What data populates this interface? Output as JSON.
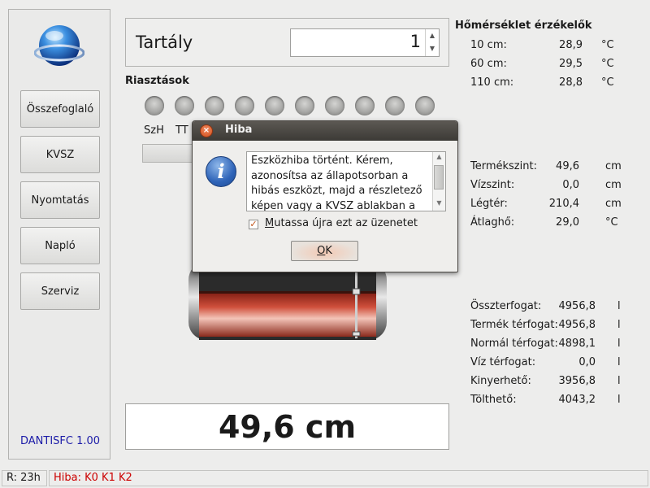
{
  "sidebar": {
    "buttons": [
      {
        "label": "Összefoglaló"
      },
      {
        "label": "KVSZ"
      },
      {
        "label": "Nyomtatás"
      },
      {
        "label": "Napló"
      },
      {
        "label": "Szerviz"
      }
    ],
    "version": "DANTISFC 1.00"
  },
  "tank_selector": {
    "label": "Tartály",
    "value": "1"
  },
  "alarms": {
    "title": "Riasztások",
    "led_count": 10,
    "labels": [
      "SzH",
      "TT"
    ]
  },
  "level_display": "49,6 cm",
  "temperature": {
    "title": "Hőmérséklet érzékelők",
    "rows": [
      {
        "label": "10 cm:",
        "value": "28,9",
        "unit": "°C"
      },
      {
        "label": "60 cm:",
        "value": "29,5",
        "unit": "°C"
      },
      {
        "label": "110 cm:",
        "value": "28,8",
        "unit": "°C"
      }
    ]
  },
  "levels": {
    "rows": [
      {
        "label": "Termékszint:",
        "value": "49,6",
        "unit": "cm"
      },
      {
        "label": "Vízszint:",
        "value": "0,0",
        "unit": "cm"
      },
      {
        "label": "Légtér:",
        "value": "210,4",
        "unit": "cm"
      },
      {
        "label": "Átlaghő:",
        "value": "29,0",
        "unit": "°C"
      }
    ]
  },
  "volumes": {
    "rows": [
      {
        "label": "Összterfogat:",
        "value": "4956,8",
        "unit": "l"
      },
      {
        "label": "Termék térfogat:",
        "value": "4956,8",
        "unit": "l"
      },
      {
        "label": "Normál térfogat:",
        "value": "4898,1",
        "unit": "l"
      },
      {
        "label": "Víz térfogat:",
        "value": "0,0",
        "unit": "l"
      },
      {
        "label": "Kinyerhető:",
        "value": "3956,8",
        "unit": "l"
      },
      {
        "label": "Tölthető:",
        "value": "4043,2",
        "unit": "l"
      }
    ]
  },
  "dialog": {
    "title": "Hiba",
    "message": "Eszközhiba történt. Kérem,\nazonosítsa az állapotsorban a\nhibás eszközt, majd a részletező\nképen vagy a KVSZ ablakban a",
    "checkbox_label": "Mutassa újra ezt az üzenetet",
    "checkbox_checked": true,
    "ok_label": "OK"
  },
  "statusbar": {
    "runtime": "R: 23h",
    "error": "Hiba: K0 K1 K2",
    "error_color": "#cc0000"
  },
  "colors": {
    "version_text": "#1c1ca8",
    "accent_orange": "#d24f1c",
    "info_blue": "#2f64b8"
  },
  "icons": {
    "logo": "blue-sphere-logo",
    "dialog_close": "close-icon",
    "dialog_info": "info-icon",
    "checkbox": "check-icon"
  }
}
